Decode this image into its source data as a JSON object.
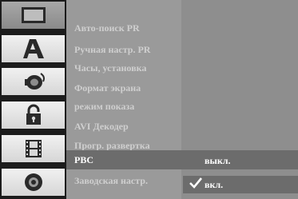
{
  "icons": [
    {
      "name": "tv-display-icon",
      "selected": true
    },
    {
      "name": "language-a-icon",
      "selected": false
    },
    {
      "name": "audio-speaker-icon",
      "selected": false
    },
    {
      "name": "lock-icon",
      "selected": false
    },
    {
      "name": "film-strip-icon",
      "selected": false
    },
    {
      "name": "disc-icon",
      "selected": false
    }
  ],
  "menu": {
    "items": [
      {
        "label": "Авто-поиск PR"
      },
      {
        "label": "Ручная настр. PR"
      },
      {
        "label": "Часы, установка"
      },
      {
        "label": "Формат экрана"
      },
      {
        "label": "режим показа"
      },
      {
        "label": "AVI Декодер"
      },
      {
        "label": "Прогр. развертка"
      },
      {
        "label": "PBC"
      },
      {
        "label": "Заводская настр."
      }
    ],
    "active_index": 7
  },
  "options": {
    "off_label": "выкл.",
    "on_label": "вкл.",
    "selected": "on_label"
  },
  "colors": {
    "icon_bg": "#e6e6e6",
    "icon_selected_bg": "#999999",
    "menu_bg": "#9a9a9a",
    "menu_text": "#cfcfcf",
    "highlight_bg": "#6c6c6c",
    "options_bg": "#8e8e8e",
    "text_active": "#ffffff"
  }
}
